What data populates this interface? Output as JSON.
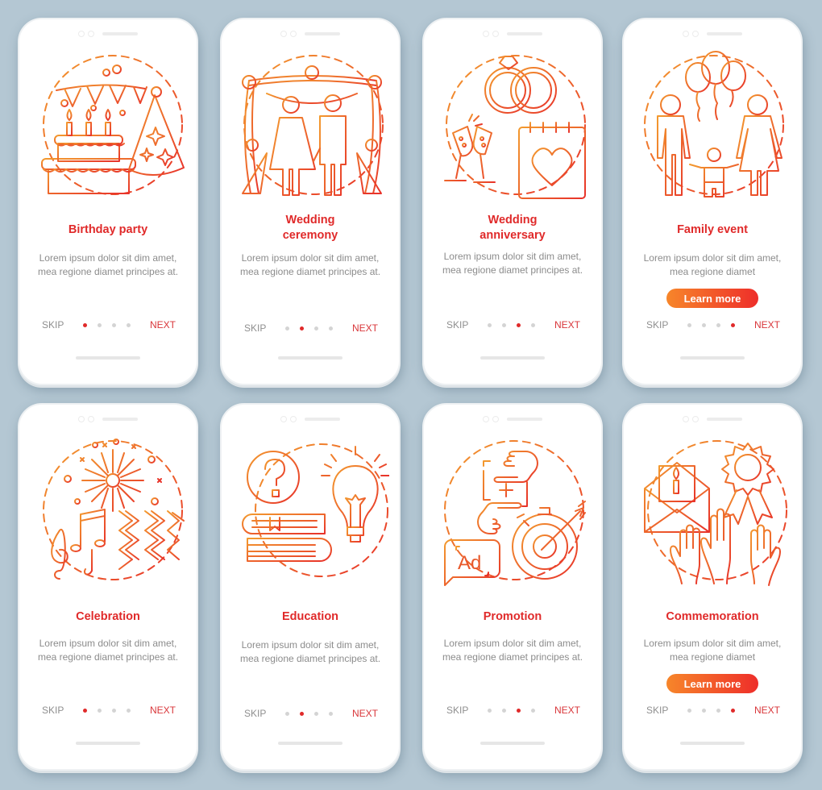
{
  "colors": {
    "background": "#b4c7d3",
    "accent_red": "#e02a2a",
    "gradient_start": "#f7862a",
    "gradient_end": "#ee2e2a",
    "body_text": "#8c8c8c",
    "dot_inactive": "#d4d4d4"
  },
  "screens": [
    {
      "title": "Birthday party",
      "body": "Lorem ipsum dolor sit dim amet, mea regione diamet principes at.",
      "icon": "birthday-cake-icon",
      "skip": "SKIP",
      "next": "NEXT",
      "active_page": 1,
      "total_pages": 4,
      "learn_more": null
    },
    {
      "title": "Wedding ceremony",
      "body": "Lorem ipsum dolor sit dim amet, mea regione diamet principes at.",
      "icon": "wedding-couple-icon",
      "skip": "SKIP",
      "next": "NEXT",
      "active_page": 2,
      "total_pages": 4,
      "learn_more": null
    },
    {
      "title": "Wedding anniversary",
      "body": "Lorem ipsum dolor sit dim amet, mea regione diamet principes at.",
      "icon": "rings-calendar-icon",
      "skip": "SKIP",
      "next": "NEXT",
      "active_page": 3,
      "total_pages": 4,
      "learn_more": null
    },
    {
      "title": "Family event",
      "body": "Lorem ipsum dolor sit dim amet, mea regione diamet",
      "icon": "family-balloons-icon",
      "skip": "SKIP",
      "next": "NEXT",
      "active_page": 4,
      "total_pages": 4,
      "learn_more": "Learn more"
    },
    {
      "title": "Celebration",
      "body": "Lorem ipsum dolor sit dim amet, mea regione diamet principes at.",
      "icon": "fireworks-music-icon",
      "skip": "SKIP",
      "next": "NEXT",
      "active_page": 1,
      "total_pages": 4,
      "learn_more": null
    },
    {
      "title": "Education",
      "body": "Lorem ipsum dolor sit dim amet, mea regione diamet principes at.",
      "icon": "books-lightbulb-icon",
      "skip": "SKIP",
      "next": "NEXT",
      "active_page": 2,
      "total_pages": 4,
      "learn_more": null
    },
    {
      "title": "Promotion",
      "body": "Lorem ipsum dolor sit dim amet, mea regione diamet principes at.",
      "icon": "ad-target-icon",
      "ad_label": "Ad",
      "skip": "SKIP",
      "next": "NEXT",
      "active_page": 3,
      "total_pages": 4,
      "learn_more": null
    },
    {
      "title": "Commemoration",
      "body": "Lorem ipsum dolor sit dim amet, mea regione diamet",
      "icon": "award-hands-icon",
      "skip": "SKIP",
      "next": "NEXT",
      "active_page": 4,
      "total_pages": 4,
      "learn_more": "Learn more"
    }
  ]
}
